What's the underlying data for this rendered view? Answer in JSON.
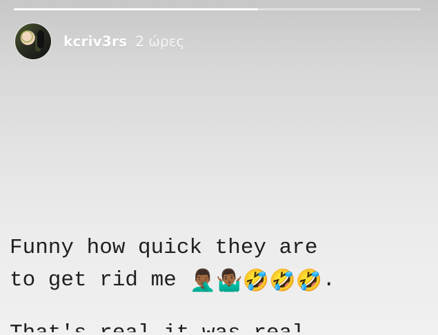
{
  "story": {
    "progress_fraction": 0.6,
    "username": "kcriv3rs",
    "timestamp": "2 ώρες",
    "line1": "Funny how quick they are",
    "line2_text": "to get rid me",
    "emoji_1": "🤦🏾‍♂️",
    "emoji_2": "🤷🏾‍♂️",
    "emoji_3": "🤣",
    "emoji_4": "🤣",
    "emoji_5": "🤣",
    "line2_end": ".",
    "line3_partial": "That's real it was real"
  }
}
